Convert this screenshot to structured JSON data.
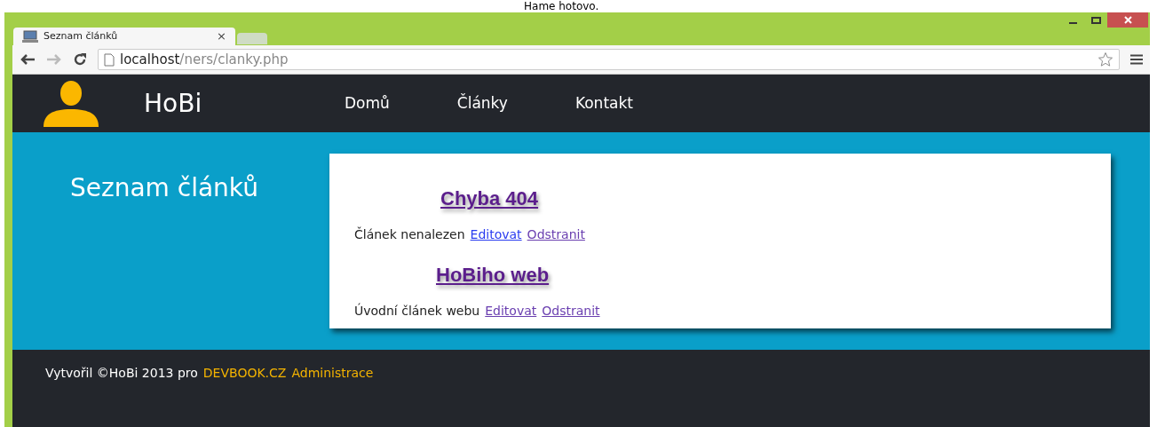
{
  "caption": "Hame hotovo.",
  "browser": {
    "tab": {
      "title": "Seznam článků",
      "close": "×"
    },
    "address": {
      "host": "localhost",
      "path": "/ners/clanky.php"
    }
  },
  "site": {
    "logo": "HoBi",
    "nav": [
      {
        "label": "Domů"
      },
      {
        "label": "Články"
      },
      {
        "label": "Kontakt"
      }
    ]
  },
  "page_title": "Seznam článků",
  "articles": [
    {
      "title": "Chyba 404",
      "description": "Článek nenalezen",
      "links": [
        {
          "label": "Editovat",
          "visited": false
        },
        {
          "label": "Odstranit",
          "visited": true
        }
      ]
    },
    {
      "title": "HoBiho web",
      "description": "Úvodní článek webu",
      "links": [
        {
          "label": "Editovat",
          "visited": true
        },
        {
          "label": "Odstranit",
          "visited": true
        }
      ]
    }
  ],
  "footer": {
    "text": "Vytvořil ©HoBi 2013 pro",
    "links": [
      "DEVBOOK.CZ",
      "Administrace"
    ]
  }
}
